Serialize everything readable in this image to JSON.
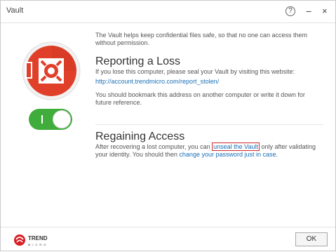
{
  "window": {
    "title": "Vault"
  },
  "intro": "The Vault helps keep confidential files safe, so that no one can access them without permission.",
  "reporting": {
    "heading": "Reporting a Loss",
    "text": "If you lose this computer, please seal your Vault by visiting this website:",
    "link": "http://account.trendmicro.com/report_stolen/",
    "note": "You should bookmark this address on another computer or write it down for future reference."
  },
  "regaining": {
    "heading": "Regaining Access",
    "text_before": "After recovering a lost computer, you can ",
    "unseal_link": "unseal the Vault",
    "text_middle": " only after validating your identity. You should then ",
    "password_link": "change your password just in case",
    "text_after": "."
  },
  "footer": {
    "brand_top": "TREND",
    "brand_bottom": "MICRO",
    "ok_label": "OK"
  },
  "colors": {
    "accent_red": "#e0402a",
    "toggle_green": "#3fac3b",
    "link_blue": "#1a6fb7"
  },
  "toggle": {
    "state": "on"
  }
}
